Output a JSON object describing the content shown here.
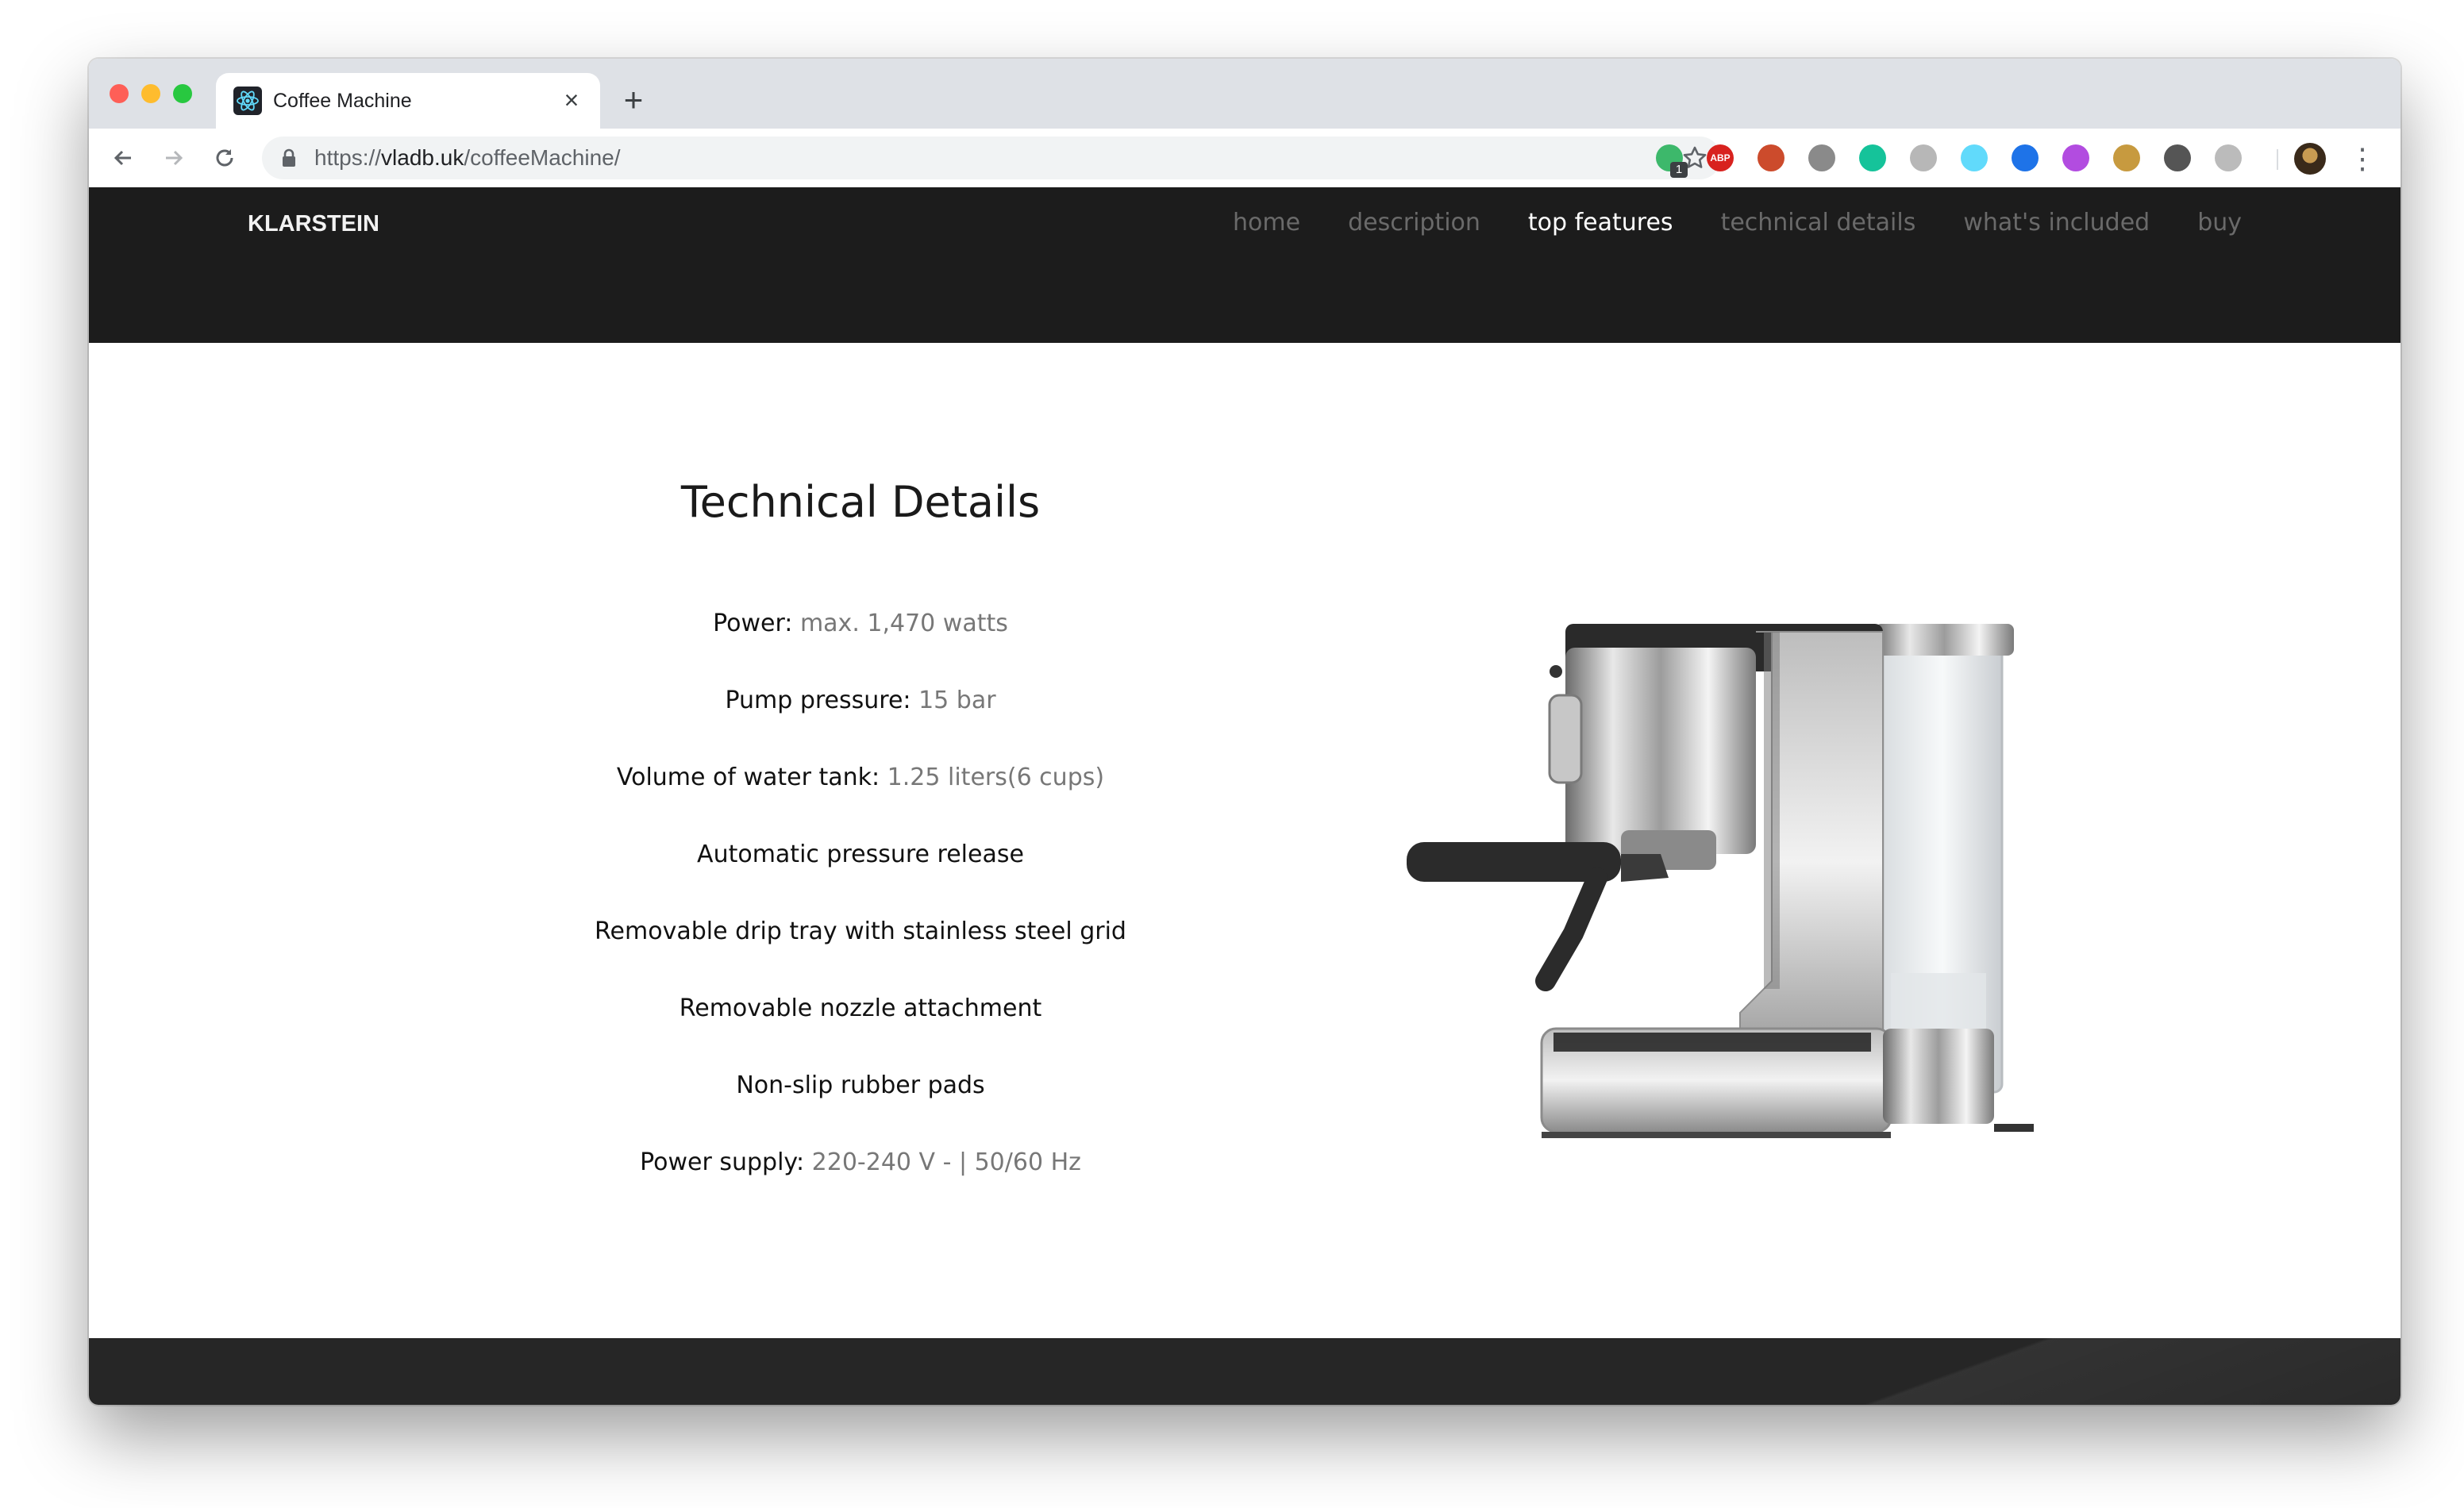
{
  "browser": {
    "tab_title": "Coffee Machine",
    "url_scheme": "https://",
    "url_host": "vladb.uk",
    "url_path": "/coffeeMachine/",
    "extensions": [
      {
        "name": "ghostery",
        "color": "#3db86b",
        "badge": "1"
      },
      {
        "name": "adblock-plus",
        "color": "#d8221e",
        "label": "ABP"
      },
      {
        "name": "glasses",
        "color": "#cc4b2c"
      },
      {
        "name": "camera",
        "color": "#8a8a8a"
      },
      {
        "name": "grammarly",
        "color": "#15c39a"
      },
      {
        "name": "translate",
        "color": "#b7b7b7"
      },
      {
        "name": "react-devtools",
        "color": "#61dafb"
      },
      {
        "name": "color-picker",
        "color": "#1e73e8"
      },
      {
        "name": "broadcast",
        "color": "#b24ce0"
      },
      {
        "name": "box",
        "color": "#c79a3f"
      },
      {
        "name": "code",
        "color": "#555555"
      },
      {
        "name": "timer",
        "color": "#bbbbbb"
      }
    ]
  },
  "site": {
    "brand": "KLARSTEIN",
    "nav": [
      {
        "label": "home",
        "active": false
      },
      {
        "label": "description",
        "active": false
      },
      {
        "label": "top features",
        "active": true
      },
      {
        "label": "technical details",
        "active": false
      },
      {
        "label": "what's included",
        "active": false
      },
      {
        "label": "buy",
        "active": false
      }
    ]
  },
  "details": {
    "title": "Technical Details",
    "specs": [
      {
        "label": "Power:",
        "value": "max. 1,470 watts"
      },
      {
        "label": "Pump pressure:",
        "value": "15 bar"
      },
      {
        "label": "Volume of water tank:",
        "value": "1.25 liters(6 cups)"
      },
      {
        "label": "Automatic pressure release",
        "value": ""
      },
      {
        "label": "Removable drip tray with stainless steel grid",
        "value": ""
      },
      {
        "label": "Removable nozzle attachment",
        "value": ""
      },
      {
        "label": "Non-slip rubber pads",
        "value": ""
      },
      {
        "label": "Power supply:",
        "value": "220-240 V - | 50/60 Hz"
      }
    ]
  }
}
